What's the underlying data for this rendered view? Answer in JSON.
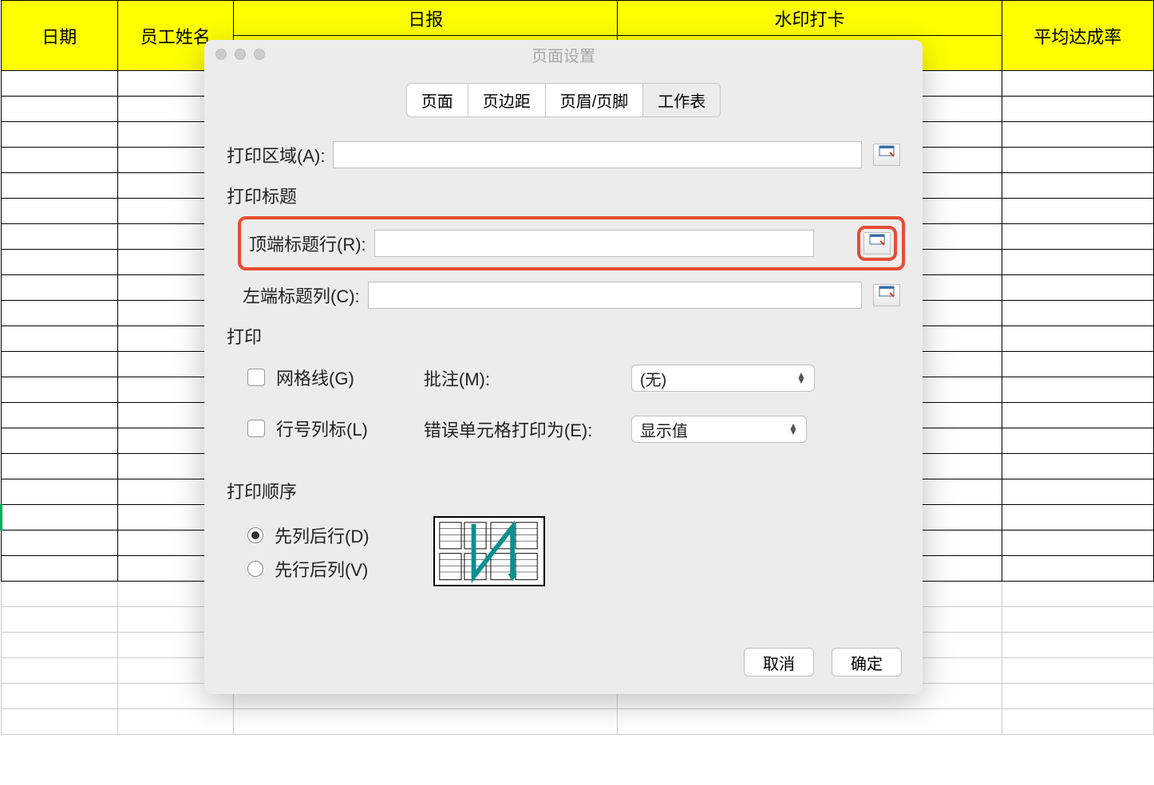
{
  "spreadsheet": {
    "headers": [
      "日期",
      "员工姓名",
      "日报",
      "水印打卡",
      "平均达成率"
    ]
  },
  "dialog": {
    "title": "页面设置",
    "tabs": [
      "页面",
      "页边距",
      "页眉/页脚",
      "工作表"
    ],
    "active_tab_index": 3,
    "print_area_label": "打印区域(A):",
    "print_area_value": "",
    "print_titles_label": "打印标题",
    "top_row_label": "顶端标题行(R):",
    "top_row_value": "",
    "left_col_label": "左端标题列(C):",
    "left_col_value": "",
    "print_section_label": "打印",
    "gridlines_label": "网格线(G)",
    "rowcol_label": "行号列标(L)",
    "comments_label": "批注(M):",
    "comments_value": "(无)",
    "errors_label": "错误单元格打印为(E):",
    "errors_value": "显示值",
    "order_section_label": "打印顺序",
    "order_down_label": "先列后行(D)",
    "order_over_label": "先行后列(V)",
    "cancel": "取消",
    "ok": "确定"
  }
}
